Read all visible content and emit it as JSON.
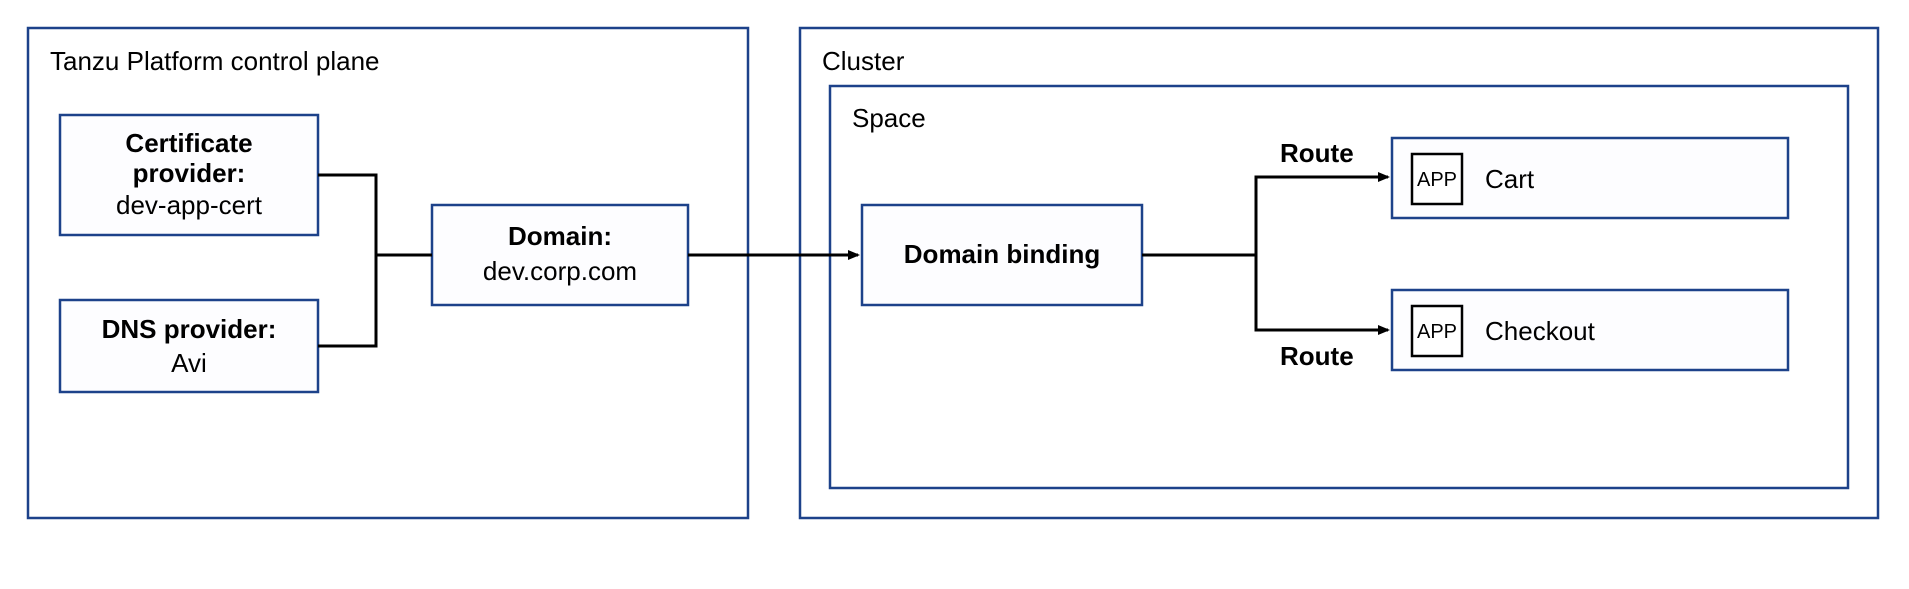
{
  "control_plane": {
    "title": "Tanzu Platform control plane",
    "cert_provider": {
      "label": "Certificate",
      "label2": "provider:",
      "value": "dev-app-cert"
    },
    "dns_provider": {
      "label": "DNS provider:",
      "value": "Avi"
    },
    "domain": {
      "label": "Domain:",
      "value": "dev.corp.com"
    }
  },
  "cluster": {
    "title": "Cluster",
    "space": {
      "title": "Space",
      "domain_binding": "Domain binding",
      "route_label": "Route",
      "app_badge": "APP",
      "app1": "Cart",
      "app2": "Checkout"
    }
  }
}
